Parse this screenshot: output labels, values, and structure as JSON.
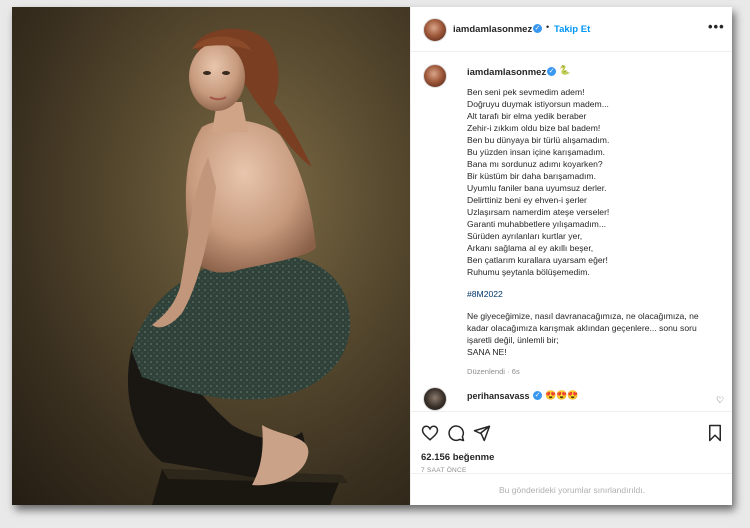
{
  "post": {
    "username": "iamdamlasonmez",
    "follow_label": "Takip Et",
    "more_label": "•••",
    "caption_emoji": "🐍",
    "caption_lines": [
      "Ben seni pek sevmedim adem!",
      "Doğruyu duymak istiyorsun madem...",
      "Alt tarafı bir elma yedik beraber",
      "Zehir-i zıkkım oldu bize bal badem!",
      "Ben bu dünyaya bir türlü alışamadım.",
      "Bu yüzden insan içine karışamadım.",
      "Bana mı sordunuz adımı koyarken?",
      "Bir küstüm bir daha barışamadım.",
      "Uyumlu faniler bana uyumsuz derler.",
      "Delirttiniz beni ey ehven-i şerler",
      "Uzlaşırsam namerdim ateşe verseler!",
      "Garanti muhabbetlere yılışamadım...",
      "Sürüden ayrılanları kurtlar yer,",
      "Arkanı sağlama al ey akıllı beşer,",
      "Ben çatlarım kurallara uyarsam eğer!",
      "Ruhumu şeytanla bölüşemedim."
    ],
    "hashtag": "#8M2022",
    "extra_lines": [
      "Ne giyeceğimize, nasıl davranacağımıza, ne olacağımıza, ne",
      "kadar olacağımıza karışmak aklından geçenlere... sonu soru",
      "işaretli değil, ünlemli bir;",
      "SANA NE!"
    ],
    "edited_label": "Düzenlendi · 6s",
    "comment": {
      "username": "perihansavass",
      "emojis": "😍😍😍"
    },
    "likes": "62.156 beğenme",
    "time_ago": "7 SAAT ÖNCE",
    "comments_limited": "Bu gönderideki yorumlar sınırlandırıldı."
  },
  "icons": {
    "verified": "verified-badge-icon",
    "more": "more-options-icon",
    "like": "heart-icon",
    "comment": "comment-icon",
    "share": "paper-plane-icon",
    "save": "bookmark-icon"
  },
  "colors": {
    "link_blue": "#0095f6",
    "verified_blue": "#3897f0",
    "text": "#262626",
    "muted": "#8e8e8e"
  }
}
